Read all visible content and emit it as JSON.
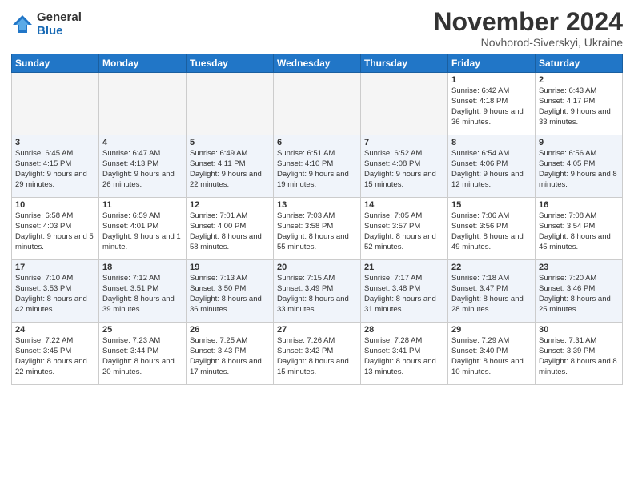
{
  "logo": {
    "general": "General",
    "blue": "Blue"
  },
  "title": "November 2024",
  "location": "Novhorod-Siverskyi, Ukraine",
  "weekdays": [
    "Sunday",
    "Monday",
    "Tuesday",
    "Wednesday",
    "Thursday",
    "Friday",
    "Saturday"
  ],
  "weeks": [
    [
      {
        "day": "",
        "info": ""
      },
      {
        "day": "",
        "info": ""
      },
      {
        "day": "",
        "info": ""
      },
      {
        "day": "",
        "info": ""
      },
      {
        "day": "",
        "info": ""
      },
      {
        "day": "1",
        "info": "Sunrise: 6:42 AM\nSunset: 4:18 PM\nDaylight: 9 hours\nand 36 minutes."
      },
      {
        "day": "2",
        "info": "Sunrise: 6:43 AM\nSunset: 4:17 PM\nDaylight: 9 hours\nand 33 minutes."
      }
    ],
    [
      {
        "day": "3",
        "info": "Sunrise: 6:45 AM\nSunset: 4:15 PM\nDaylight: 9 hours\nand 29 minutes."
      },
      {
        "day": "4",
        "info": "Sunrise: 6:47 AM\nSunset: 4:13 PM\nDaylight: 9 hours\nand 26 minutes."
      },
      {
        "day": "5",
        "info": "Sunrise: 6:49 AM\nSunset: 4:11 PM\nDaylight: 9 hours\nand 22 minutes."
      },
      {
        "day": "6",
        "info": "Sunrise: 6:51 AM\nSunset: 4:10 PM\nDaylight: 9 hours\nand 19 minutes."
      },
      {
        "day": "7",
        "info": "Sunrise: 6:52 AM\nSunset: 4:08 PM\nDaylight: 9 hours\nand 15 minutes."
      },
      {
        "day": "8",
        "info": "Sunrise: 6:54 AM\nSunset: 4:06 PM\nDaylight: 9 hours\nand 12 minutes."
      },
      {
        "day": "9",
        "info": "Sunrise: 6:56 AM\nSunset: 4:05 PM\nDaylight: 9 hours\nand 8 minutes."
      }
    ],
    [
      {
        "day": "10",
        "info": "Sunrise: 6:58 AM\nSunset: 4:03 PM\nDaylight: 9 hours\nand 5 minutes."
      },
      {
        "day": "11",
        "info": "Sunrise: 6:59 AM\nSunset: 4:01 PM\nDaylight: 9 hours\nand 1 minute."
      },
      {
        "day": "12",
        "info": "Sunrise: 7:01 AM\nSunset: 4:00 PM\nDaylight: 8 hours\nand 58 minutes."
      },
      {
        "day": "13",
        "info": "Sunrise: 7:03 AM\nSunset: 3:58 PM\nDaylight: 8 hours\nand 55 minutes."
      },
      {
        "day": "14",
        "info": "Sunrise: 7:05 AM\nSunset: 3:57 PM\nDaylight: 8 hours\nand 52 minutes."
      },
      {
        "day": "15",
        "info": "Sunrise: 7:06 AM\nSunset: 3:56 PM\nDaylight: 8 hours\nand 49 minutes."
      },
      {
        "day": "16",
        "info": "Sunrise: 7:08 AM\nSunset: 3:54 PM\nDaylight: 8 hours\nand 45 minutes."
      }
    ],
    [
      {
        "day": "17",
        "info": "Sunrise: 7:10 AM\nSunset: 3:53 PM\nDaylight: 8 hours\nand 42 minutes."
      },
      {
        "day": "18",
        "info": "Sunrise: 7:12 AM\nSunset: 3:51 PM\nDaylight: 8 hours\nand 39 minutes."
      },
      {
        "day": "19",
        "info": "Sunrise: 7:13 AM\nSunset: 3:50 PM\nDaylight: 8 hours\nand 36 minutes."
      },
      {
        "day": "20",
        "info": "Sunrise: 7:15 AM\nSunset: 3:49 PM\nDaylight: 8 hours\nand 33 minutes."
      },
      {
        "day": "21",
        "info": "Sunrise: 7:17 AM\nSunset: 3:48 PM\nDaylight: 8 hours\nand 31 minutes."
      },
      {
        "day": "22",
        "info": "Sunrise: 7:18 AM\nSunset: 3:47 PM\nDaylight: 8 hours\nand 28 minutes."
      },
      {
        "day": "23",
        "info": "Sunrise: 7:20 AM\nSunset: 3:46 PM\nDaylight: 8 hours\nand 25 minutes."
      }
    ],
    [
      {
        "day": "24",
        "info": "Sunrise: 7:22 AM\nSunset: 3:45 PM\nDaylight: 8 hours\nand 22 minutes."
      },
      {
        "day": "25",
        "info": "Sunrise: 7:23 AM\nSunset: 3:44 PM\nDaylight: 8 hours\nand 20 minutes."
      },
      {
        "day": "26",
        "info": "Sunrise: 7:25 AM\nSunset: 3:43 PM\nDaylight: 8 hours\nand 17 minutes."
      },
      {
        "day": "27",
        "info": "Sunrise: 7:26 AM\nSunset: 3:42 PM\nDaylight: 8 hours\nand 15 minutes."
      },
      {
        "day": "28",
        "info": "Sunrise: 7:28 AM\nSunset: 3:41 PM\nDaylight: 8 hours\nand 13 minutes."
      },
      {
        "day": "29",
        "info": "Sunrise: 7:29 AM\nSunset: 3:40 PM\nDaylight: 8 hours\nand 10 minutes."
      },
      {
        "day": "30",
        "info": "Sunrise: 7:31 AM\nSunset: 3:39 PM\nDaylight: 8 hours\nand 8 minutes."
      }
    ]
  ]
}
